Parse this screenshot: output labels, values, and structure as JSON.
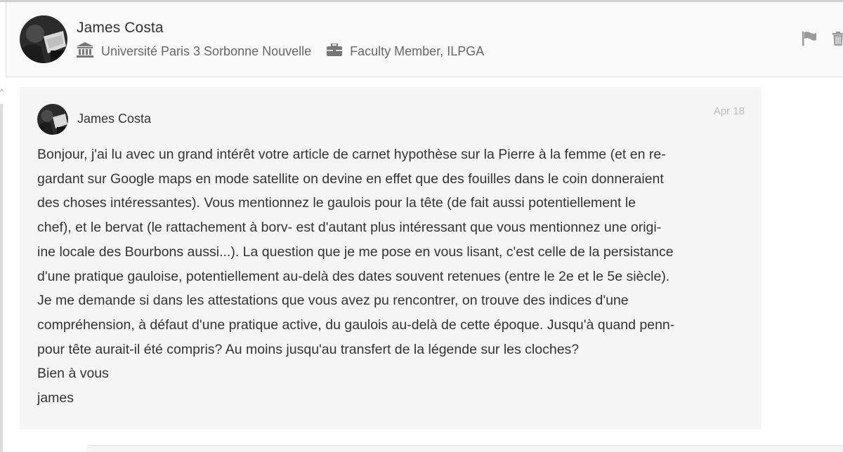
{
  "header": {
    "name": "James Costa",
    "institution": "Université Paris 3 Sorbonne Nouvelle",
    "position": "Faculty Member, ILPGA",
    "icons": {
      "institution": "institution-building-icon",
      "position": "briefcase-icon",
      "flag": "flag-icon",
      "delete": "trash-icon"
    }
  },
  "message": {
    "author": "James Costa",
    "date": "Apr 18",
    "body_lines": [
      "Bonjour, j'ai lu avec un grand intérêt votre article de carnet hypothèse sur la Pierre à la femme (et en re-",
      "gardant sur Google maps en mode satellite on devine en effet que des fouilles dans le coin donneraient",
      "des choses intéressantes). Vous mentionnez le gaulois pour la tête (de fait aussi potentiellement le",
      "chef), et le bervat (le rattachement à borv- est d'autant plus intéressant que vous mentionnez une origi-",
      "ine locale des Bourbons aussi...). La question que je me pose en vous lisant, c'est celle de la persistance",
      "d'une pratique gauloise, potentiellement au-delà des dates souvent retenues (entre le 2e et le 5e siècle).",
      "Je me demande si dans les attestations que vous avez pu rencontrer, on trouve des indices d'une",
      "compréhension, à défaut d'une pratique active, du gaulois au-delà de cette époque. Jusqu'à quand penn-",
      "pour tête aurait-il été compris? Au moins jusqu'au transfert de la légende sur les cloches?",
      "Bien à vous",
      "james"
    ]
  }
}
